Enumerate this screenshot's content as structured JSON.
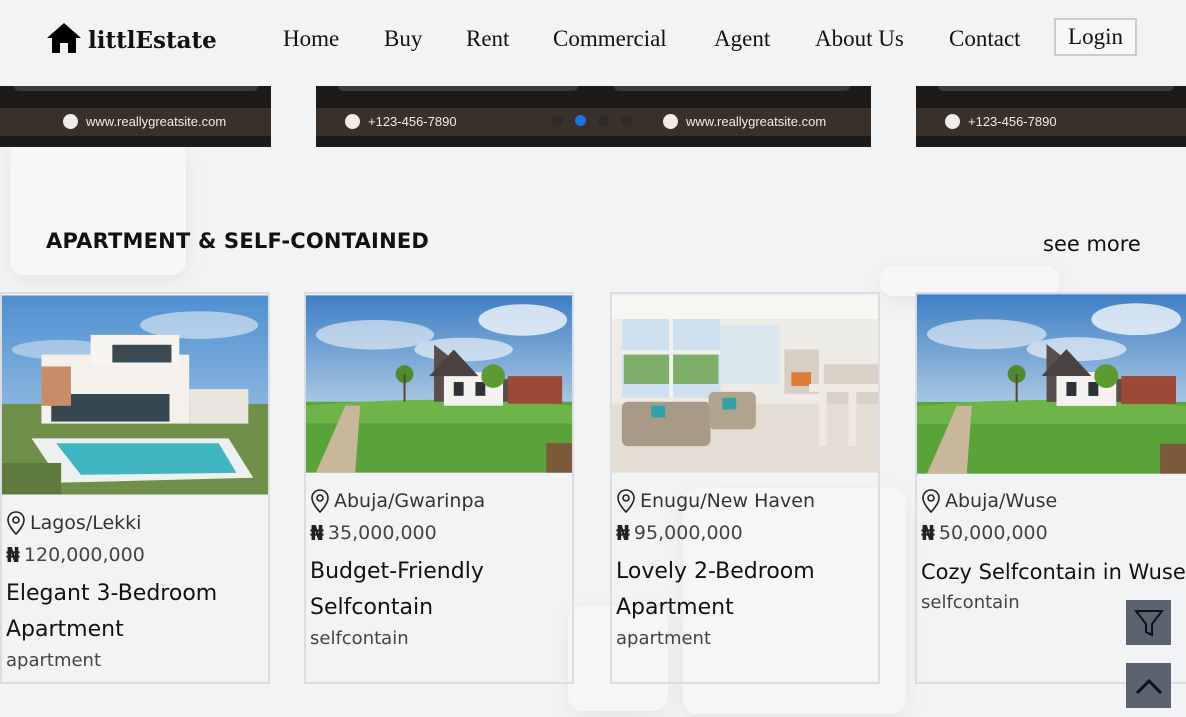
{
  "brand": {
    "name": "littlEstate"
  },
  "nav": {
    "items": [
      "Home",
      "Buy",
      "Rent",
      "Commercial",
      "Agent",
      "About Us",
      "Contact"
    ],
    "login": "Login"
  },
  "banners": {
    "website": "www.reallygreatsite.com",
    "phone": "+123-456-7890",
    "active_dot": 2
  },
  "section": {
    "title": "APARTMENT & SELF-CONTAINED",
    "see_more": "see more"
  },
  "listings": [
    {
      "location": "Lagos/Lekki",
      "price": "120,000,000",
      "title": "Elegant 3-Bedroom Apartment",
      "type": "apartment",
      "image": "modern-villa-pool"
    },
    {
      "location": "Abuja/Gwarinpa",
      "price": "35,000,000",
      "title": "Budget-Friendly Selfcontain",
      "type": "selfcontain",
      "image": "suburban-house-lawn"
    },
    {
      "location": "Enugu/New Haven",
      "price": "95,000,000",
      "title": "Lovely 2-Bedroom Apartment",
      "type": "apartment",
      "image": "bright-living-room"
    },
    {
      "location": "Abuja/Wuse",
      "price": "50,000,000",
      "title": "Cozy Selfcontain in Wuse",
      "type": "selfcontain",
      "image": "suburban-house-lawn"
    }
  ],
  "currency_symbol": "₦",
  "icons": {
    "filter": "filter-icon",
    "scroll_top": "chevron-up-icon",
    "location": "map-pin-icon",
    "home": "house-icon"
  },
  "colors": {
    "accent": "#1a73e8",
    "fab": "#5b6270",
    "banner": "#1d1b1a"
  }
}
